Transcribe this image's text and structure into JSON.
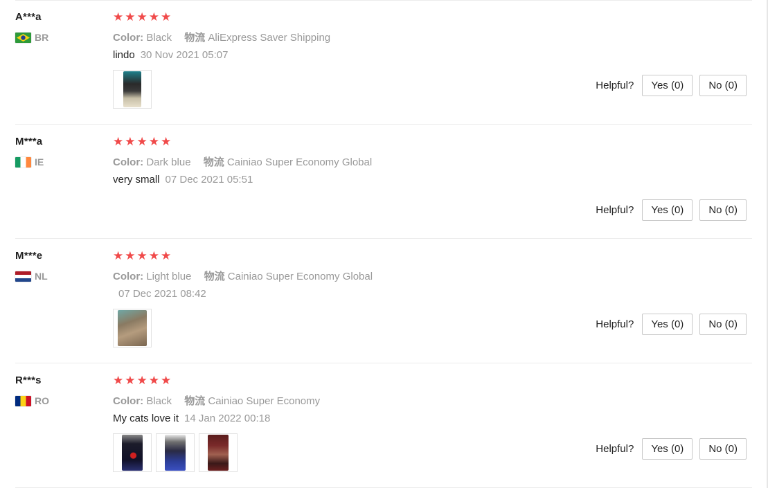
{
  "helpful_label": "Helpful?",
  "reviews": [
    {
      "user": "A***a",
      "country": "BR",
      "rating_stars": 5,
      "color_label": "Color:",
      "color_value": "Black",
      "shipping_label": "物流",
      "shipping_value": "AliExpress Saver Shipping",
      "feedback": "lindo",
      "date": "30 Nov 2021 05:07",
      "photos": [
        "photo-1"
      ],
      "yes_label": "Yes (0)",
      "no_label": "No (0)"
    },
    {
      "user": "M***a",
      "country": "IE",
      "rating_stars": 5,
      "color_label": "Color:",
      "color_value": "Dark blue",
      "shipping_label": "物流",
      "shipping_value": "Cainiao Super Economy Global",
      "feedback": "very small",
      "date": "07 Dec 2021 05:51",
      "photos": [],
      "yes_label": "Yes (0)",
      "no_label": "No (0)"
    },
    {
      "user": "M***e",
      "country": "NL",
      "rating_stars": 5,
      "color_label": "Color:",
      "color_value": "Light blue",
      "shipping_label": "物流",
      "shipping_value": "Cainiao Super Economy Global",
      "feedback": "",
      "date": "07 Dec 2021 08:42",
      "photos": [
        "photo-1"
      ],
      "yes_label": "Yes (0)",
      "no_label": "No (0)"
    },
    {
      "user": "R***s",
      "country": "RO",
      "rating_stars": 5,
      "color_label": "Color:",
      "color_value": "Black",
      "shipping_label": "物流",
      "shipping_value": "Cainiao Super Economy",
      "feedback": "My cats love it",
      "date": "14 Jan 2022 00:18",
      "photos": [
        "photo-1",
        "photo-2",
        "photo-3"
      ],
      "yes_label": "Yes (0)",
      "no_label": "No (0)"
    }
  ],
  "colors": {
    "star": "#f04a4a",
    "muted": "#999999",
    "text": "#222222",
    "divider": "#ececec"
  }
}
